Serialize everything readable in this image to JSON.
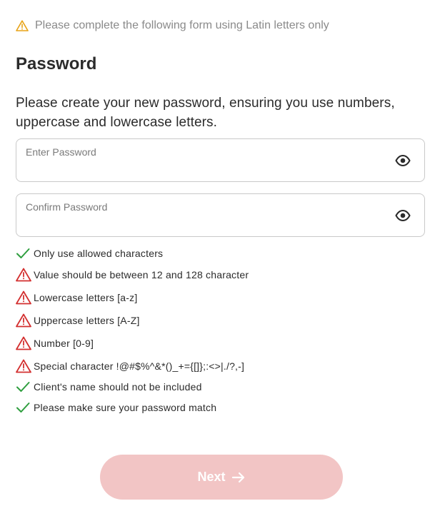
{
  "notice": {
    "icon": "warning-triangle-icon",
    "text": "Please complete the following form using Latin letters only"
  },
  "page_title": "Password",
  "instructions": "Please create your new password, ensuring you use numbers, uppercase and lowercase letters.",
  "fields": {
    "password": {
      "label": "Enter Password",
      "value": "",
      "icon": "eye-icon"
    },
    "confirm": {
      "label": "Confirm Password",
      "value": "",
      "icon": "eye-icon"
    }
  },
  "rules": [
    {
      "text": "Only use allowed characters",
      "status": "ok"
    },
    {
      "text": "Value should be between 12 and 128 character",
      "status": "error"
    },
    {
      "text": "Lowercase letters [a-z]",
      "status": "error"
    },
    {
      "text": "Uppercase letters [A-Z]",
      "status": "error"
    },
    {
      "text": "Number [0-9]",
      "status": "error"
    },
    {
      "text": "Special character !@#$%^&*()_+={[]};:<>|./?,-]",
      "status": "error"
    },
    {
      "text": "Client's name should not be included",
      "status": "ok"
    },
    {
      "text": "Please make sure your password match",
      "status": "ok"
    }
  ],
  "next_button": {
    "label": "Next",
    "icon": "arrow-right-icon",
    "enabled": false
  },
  "colors": {
    "ok": "#2e9e3e",
    "error": "#d32f2f",
    "notice_icon": "#e8a317",
    "button_disabled": "#f2c5c5"
  }
}
